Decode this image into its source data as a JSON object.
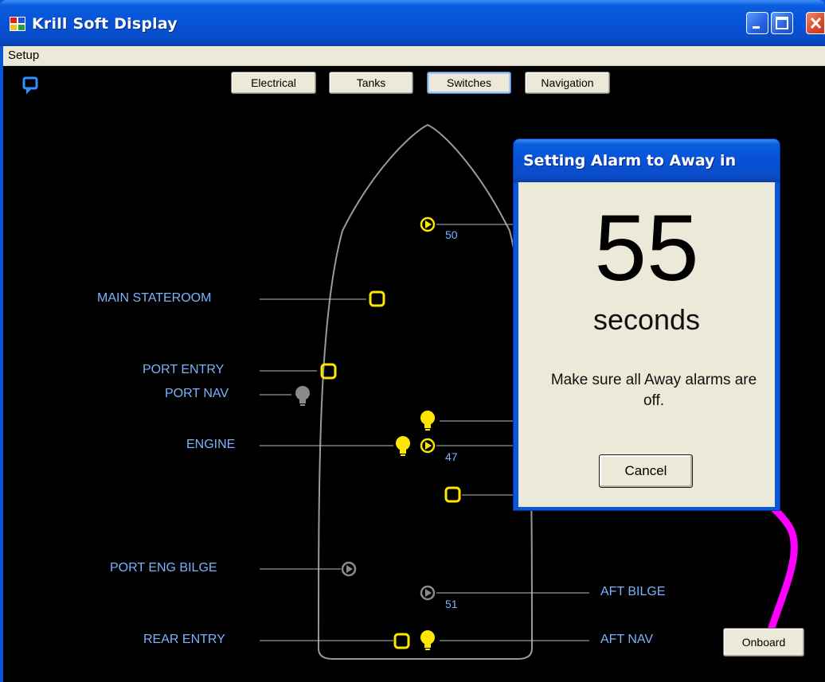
{
  "window": {
    "title": "Krill Soft Display"
  },
  "menu": {
    "setup": "Setup"
  },
  "tabs": [
    {
      "label": "Electrical",
      "active": false
    },
    {
      "label": "Tanks",
      "active": false
    },
    {
      "label": "Switches",
      "active": true
    },
    {
      "label": "Navigation",
      "active": false
    }
  ],
  "labels": {
    "main_stateroom": "MAIN STATEROOM",
    "port_entry": "PORT ENTRY",
    "port_nav": "PORT NAV",
    "engine": "ENGINE",
    "port_eng_bilge": "PORT ENG BILGE",
    "aft_bilge": "AFT BILGE",
    "rear_entry": "REAR ENTRY",
    "aft_nav": "AFT NAV"
  },
  "readings": {
    "bow_pump": "50",
    "engine_pump": "47",
    "aft_bilge_pump": "51"
  },
  "dialog": {
    "title": "Setting Alarm to Away in",
    "count": "55",
    "unit": "seconds",
    "message": "Make sure all Away alarms are off.",
    "cancel": "Cancel"
  },
  "onboard_button": "Onboard",
  "colors": {
    "label": "#7bb3ff",
    "active_yellow": "#ffe600",
    "inactive_gray": "#8a8a8a",
    "hull": "#9a9a9a",
    "arrow": "#ff00ff"
  }
}
